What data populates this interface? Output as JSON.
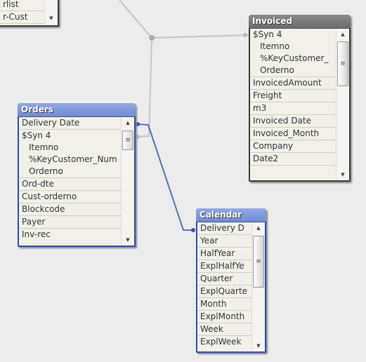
{
  "tables": {
    "partial": {
      "fields": [
        "rlist",
        "r-Cust"
      ]
    },
    "invoiced": {
      "title": "Invoiced",
      "fields": [
        "$Syn 4",
        "Itemno",
        "%KeyCustomer_",
        "Orderno",
        "InvoicedAmount",
        "Freight",
        "m3",
        "Invoiced Date",
        "Invoiced_Month",
        "Company",
        "Date2"
      ]
    },
    "orders": {
      "title": "Orders",
      "fields": [
        "Delivery Date",
        "$Syn 4",
        "Itemno",
        "%KeyCustomer_Num",
        "Orderno",
        "Ord-dte",
        "Cust-orderno",
        "Blockcode",
        "Payer",
        "Inv-rec"
      ]
    },
    "calendar": {
      "title": "Calendar",
      "fields": [
        "Delivery D",
        "Year",
        "HalfYear",
        "ExplHalfYe",
        "Quarter",
        "ExplQuarte",
        "Month",
        "ExplMonth",
        "Week",
        "ExplWeek"
      ]
    }
  },
  "colors": {
    "link_gray": "#c4c4c4",
    "link_blue": "#5a70b0",
    "header_blue": "#7a93da",
    "header_gray": "#767676"
  },
  "icons": {
    "scroll_up": "▲",
    "scroll_down": "▼",
    "thumb": "≡"
  }
}
